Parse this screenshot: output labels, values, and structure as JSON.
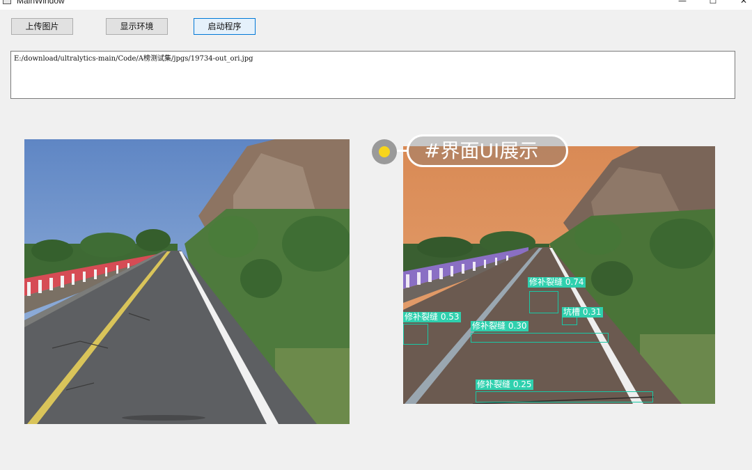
{
  "window": {
    "title": "MainWindow",
    "minimize_glyph": "—",
    "maximize_glyph": "☐",
    "close_glyph": "✕"
  },
  "toolbar": {
    "upload_label": "上传图片",
    "env_label": "显示环境",
    "run_label": "启动程序"
  },
  "path_box": {
    "value": "E:/download/ultralytics-main/Code/A榜测试集/jpgs/19734-out_ori.jpg"
  },
  "overlay": {
    "badge_text": "#界面UI展示"
  },
  "detections": [
    {
      "label": "修补裂缝 0.74"
    },
    {
      "label": "修补裂缝 0.53"
    },
    {
      "label": "坑槽 0.31"
    },
    {
      "label": "修补裂缝 0.30"
    },
    {
      "label": "修补裂缝 0.25"
    }
  ],
  "colors": {
    "detection_box": "#18c9a6",
    "detection_label_bg": "#2fd0ae",
    "focused_button_border": "#0078d7",
    "badge_dot": "#f7d51c"
  }
}
